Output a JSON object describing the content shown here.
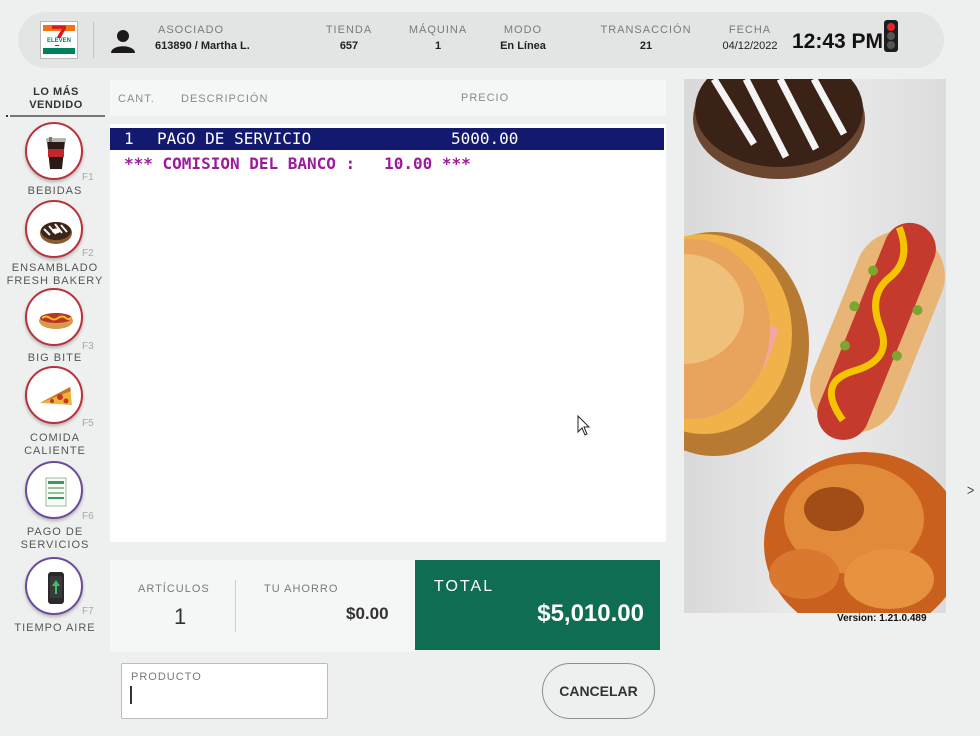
{
  "header": {
    "logo_text": "ELEVEN",
    "logo_number": "7",
    "fields": [
      {
        "label": "ASOCIADO",
        "value": "613890 / Martha L."
      },
      {
        "label": "TIENDA",
        "value": "657"
      },
      {
        "label": "MÁQUINA",
        "value": "1"
      },
      {
        "label": "MODO",
        "value": "En Línea"
      },
      {
        "label": "TRANSACCIÓN",
        "value": "21"
      },
      {
        "label": "FECHA",
        "value": "04/12/2022"
      }
    ],
    "clock": "12:43 PM",
    "status_light": "red"
  },
  "sidebar": {
    "title": "LO MÁS VENDIDO",
    "categories": [
      {
        "label": "BEBIDAS",
        "key": "F1",
        "icon": "drink-cup-icon"
      },
      {
        "label": "ENSAMBLADO FRESH BAKERY",
        "key": "F2",
        "icon": "donut-icon"
      },
      {
        "label": "BIG BITE",
        "key": "F3",
        "icon": "hotdog-icon"
      },
      {
        "label": "COMIDA CALIENTE",
        "key": "F5",
        "icon": "pizza-slice-icon"
      },
      {
        "label": "PAGO DE SERVICIOS",
        "key": "F6",
        "icon": "receipt-icon"
      },
      {
        "label": "TIEMPO AIRE",
        "key": "F7",
        "icon": "mobile-phone-icon"
      }
    ]
  },
  "receipt": {
    "columns": {
      "qty": "CANT.",
      "description": "DESCRIPCIÓN",
      "price": "PRECIO"
    },
    "items": [
      {
        "qty": "1",
        "description": "PAGO DE SERVICIO",
        "price": "5000.00"
      }
    ],
    "note": "*** COMISION DEL BANCO :   10.00 ***"
  },
  "totals": {
    "items_label": "ARTÍCULOS",
    "items_value": "1",
    "savings_label": "TU AHORRO",
    "savings_value": "$0.00",
    "total_label": "TOTAL",
    "total_value": "$5,010.00"
  },
  "product_input": {
    "label": "PRODUCTO",
    "value": ""
  },
  "cancel_button": "CANCELAR",
  "version": "Version: 1.21.0.489",
  "edge_mark": "ᐳ",
  "colors": {
    "total_bg": "#0e6d52",
    "selected_row": "#12196e",
    "commission_text": "#9b1b9b",
    "category_ring": "#b9323b",
    "service_ring": "#6b4a9c"
  }
}
